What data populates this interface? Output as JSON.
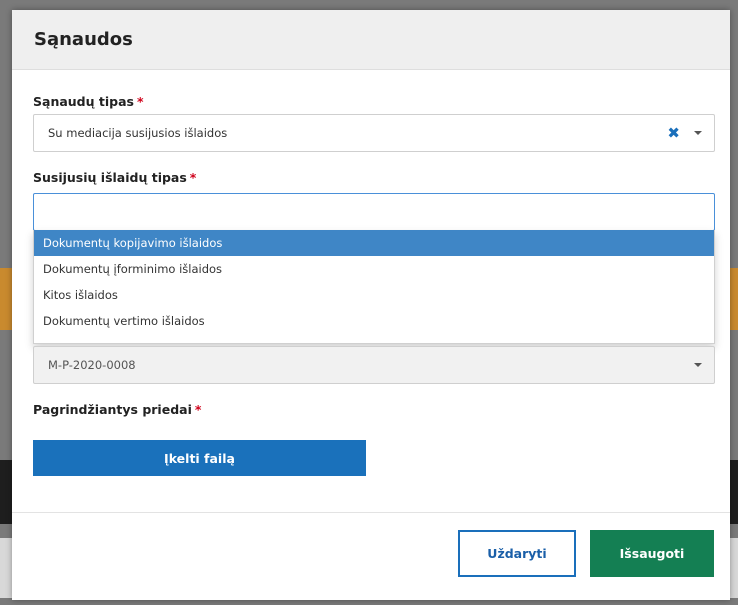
{
  "modal": {
    "title": "Sąnaudos"
  },
  "fields": {
    "expense_type": {
      "label": "Sąnaudų tipas",
      "required_mark": "*",
      "value": "Su mediacija susijusios išlaidos"
    },
    "related_expense_type": {
      "label": "Susijusių išlaidų tipas",
      "required_mark": "*",
      "search_value": "",
      "options": [
        "Dokumentų kopijavimo išlaidos",
        "Dokumentų įforminimo išlaidos",
        "Kitos išlaidos",
        "Dokumentų vertimo išlaidos"
      ],
      "highlighted_index": 0
    },
    "case_number": {
      "value": "M-P-2020-0008"
    },
    "attachments": {
      "label": "Pagrindžiantys priedai",
      "required_mark": "*",
      "upload_label": "Įkelti failą"
    }
  },
  "footer": {
    "close_label": "Uždaryti",
    "save_label": "Išsaugoti"
  },
  "colors": {
    "primary_blue": "#1a71bb",
    "save_green": "#147f53",
    "highlight_blue": "#3f86c6",
    "required_red": "#d0021b"
  },
  "icons": [
    "clear-icon",
    "chevron-down-icon"
  ]
}
